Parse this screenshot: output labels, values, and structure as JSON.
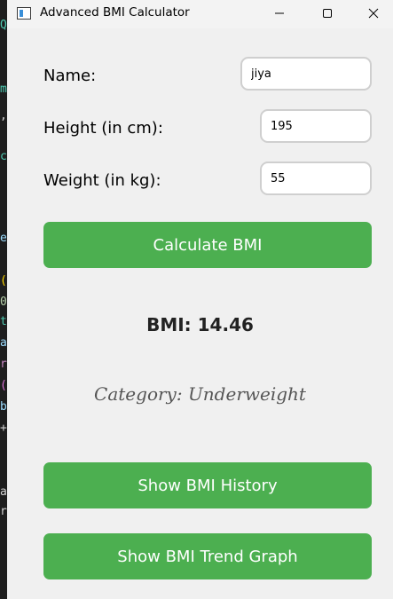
{
  "window": {
    "title": "Advanced BMI Calculator",
    "controls": {
      "minimize": "—",
      "maximize": "☐",
      "close": "✕"
    }
  },
  "form": {
    "name_label": "Name:",
    "name_value": "jiya",
    "height_label": "Height (in cm):",
    "height_value": "195",
    "weight_label": "Weight (in kg):",
    "weight_value": "55"
  },
  "actions": {
    "calculate_label": "Calculate BMI",
    "history_label": "Show BMI History",
    "trend_label": "Show BMI Trend Graph"
  },
  "result": {
    "bmi_text": "BMI: 14.46",
    "category_text": "Category: Underweight"
  },
  "colors": {
    "accent": "#4caf50",
    "window_bg": "#f0f0f0"
  }
}
